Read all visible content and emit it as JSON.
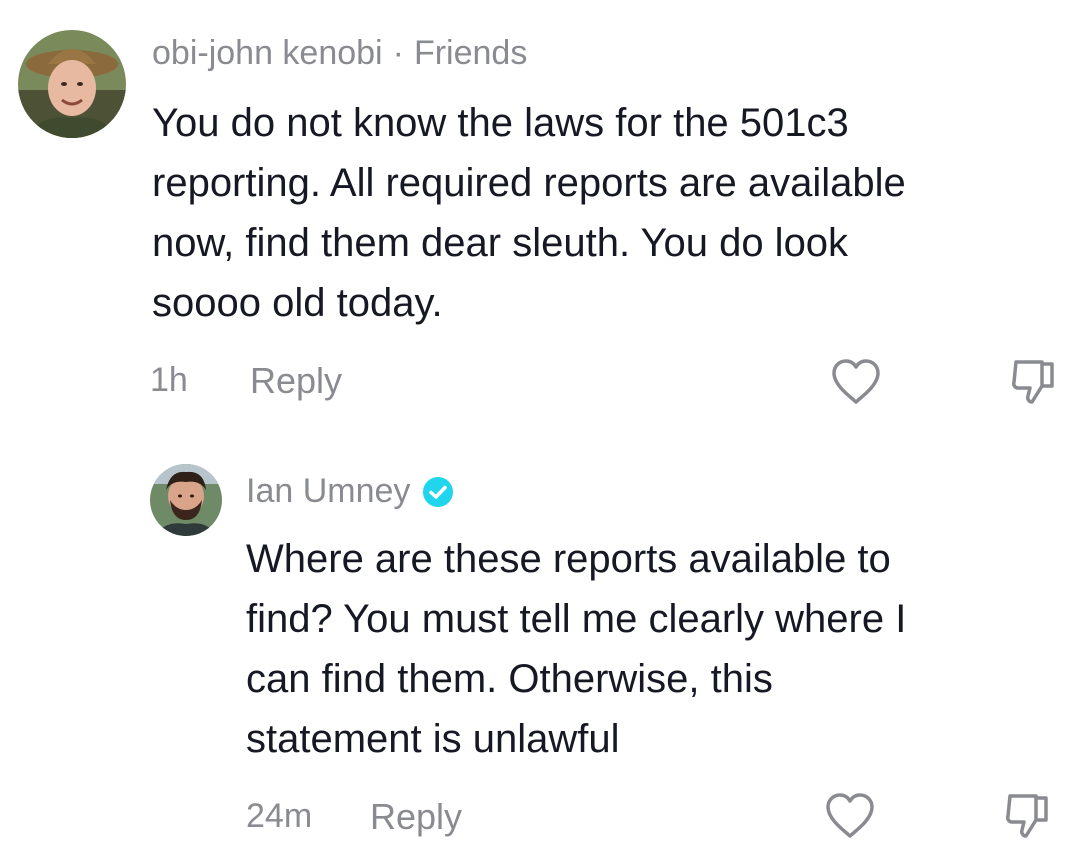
{
  "comments": [
    {
      "username": "obi-john kenobi",
      "separator": "·",
      "relation": "Friends",
      "avatar_icon": "person-with-hat-avatar",
      "text_lines": [
        "You do not know the laws for the 501c3",
        "reporting. All required reports are available",
        "now, find them dear sleuth. You do look",
        "soooo old today."
      ],
      "time": "1h",
      "reply_label": "Reply",
      "like_icon": "heart-outline-icon",
      "dislike_icon": "thumbs-down-icon"
    },
    {
      "username": "Ian Umney",
      "verified": true,
      "verified_color": "#20d5ec",
      "avatar_icon": "bearded-man-avatar",
      "text_lines": [
        "Where are these reports available to",
        "find? You must tell me clearly where I",
        "can find them. Otherwise, this",
        "statement is unlawful"
      ],
      "time": "24m",
      "reply_label": "Reply",
      "like_icon": "heart-outline-icon",
      "dislike_icon": "thumbs-down-icon"
    }
  ],
  "colors": {
    "text": "#161823",
    "secondary": "#8a8b91",
    "background": "#ffffff"
  }
}
